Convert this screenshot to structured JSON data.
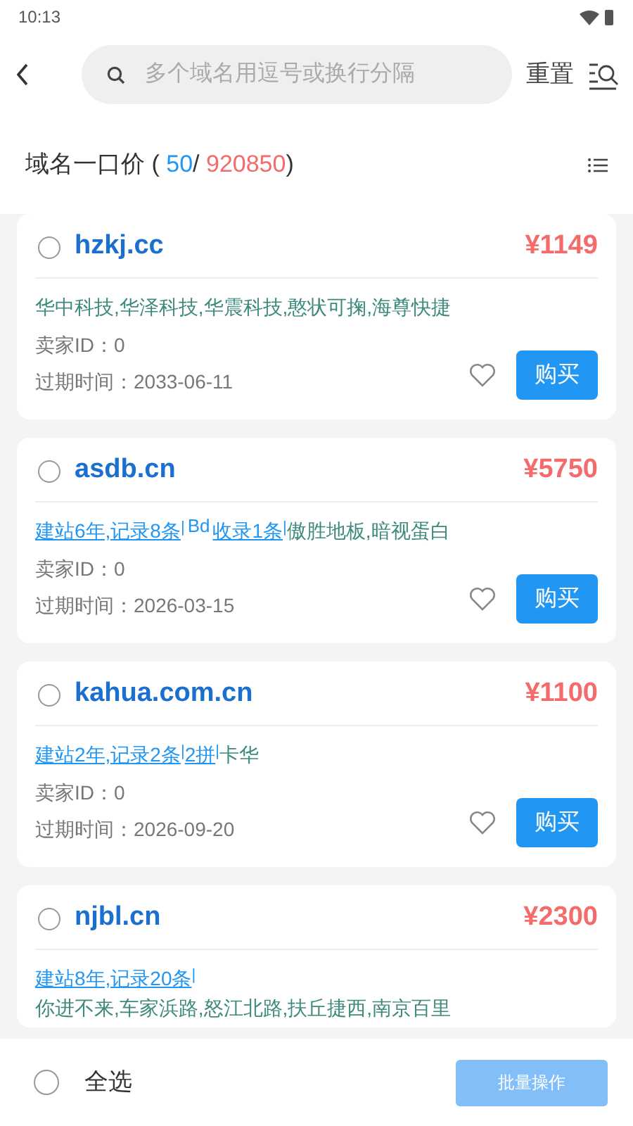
{
  "status_bar": {
    "time": "10:13"
  },
  "header": {
    "search": {
      "placeholder": "多个域名用逗号或换行分隔"
    },
    "reset": "重置"
  },
  "title": {
    "label": "域名一口价 (",
    "shown": "50",
    "sep": "/",
    "total": "920850",
    "close": ")"
  },
  "listings": [
    {
      "domain": "hzkj.cc",
      "checked": false,
      "price": "¥1149",
      "tags": [
        {
          "kind": "plain",
          "text": "华中科技,华泽科技,华震科技,憨状可掬,海尊快捷"
        }
      ],
      "seller": "卖家ID：0",
      "expires": "过期时间：2033-06-11",
      "favorite": false,
      "buy": "购买"
    },
    {
      "domain": "asdb.cn",
      "checked": false,
      "price": "¥5750",
      "tags": [
        {
          "kind": "link",
          "text": "建站6年,记录8条"
        },
        {
          "kind": "sep",
          "text": "|"
        },
        {
          "kind": "sup",
          "text": "Bd"
        },
        {
          "kind": "link",
          "text": "收录1条"
        },
        {
          "kind": "sep",
          "text": "|"
        },
        {
          "kind": "plain",
          "text": "傲胜地板,暗视蛋白"
        }
      ],
      "seller": "卖家ID：0",
      "expires": "过期时间：2026-03-15",
      "favorite": false,
      "buy": "购买"
    },
    {
      "domain": "kahua.com.cn",
      "checked": false,
      "price": "¥1100",
      "tags": [
        {
          "kind": "link",
          "text": "建站2年,记录2条"
        },
        {
          "kind": "sep",
          "text": "|"
        },
        {
          "kind": "link",
          "text": "2拼"
        },
        {
          "kind": "sep",
          "text": "|"
        },
        {
          "kind": "plain",
          "text": "卡华"
        }
      ],
      "seller": "卖家ID：0",
      "expires": "过期时间：2026-09-20",
      "favorite": false,
      "buy": "购买"
    },
    {
      "domain": "njbl.cn",
      "checked": false,
      "price": "¥2300",
      "tags": [
        {
          "kind": "link",
          "text": "建站8年,记录20条"
        },
        {
          "kind": "sep",
          "text": "|"
        },
        {
          "kind": "line",
          "text": "你进不来,车家浜路,怒江北路,扶丘捷西,南京百里"
        }
      ]
    }
  ],
  "footer": {
    "select_all": "全选",
    "checked": false,
    "batch": "批量操作",
    "batch_disabled": true
  }
}
